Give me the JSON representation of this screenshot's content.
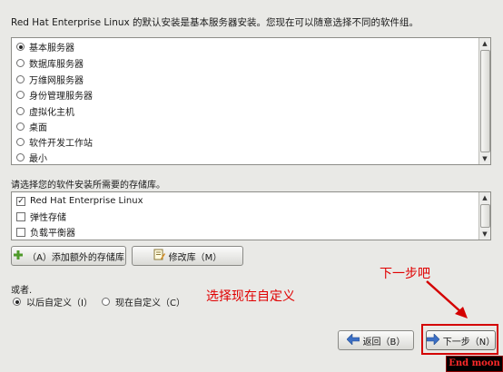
{
  "intro_text": "Red Hat Enterprise Linux 的默认安装是基本服务器安装。您现在可以随意选择不同的软件组。",
  "software_groups": {
    "selected_index": 0,
    "items": [
      "基本服务器",
      "数据库服务器",
      "万维网服务器",
      "身份管理服务器",
      "虚拟化主机",
      "桌面",
      "软件开发工作站",
      "最小"
    ]
  },
  "repo_prompt": "请选择您的软件安装所需要的存储库。",
  "repositories": [
    {
      "label": "Red Hat Enterprise Linux",
      "checked": true
    },
    {
      "label": "弹性存储",
      "checked": false
    },
    {
      "label": "负载平衡器",
      "checked": false
    }
  ],
  "add_repo_button": "（A）添加额外的存储库",
  "modify_repo_button": "修改库（M）",
  "or_label": "或者.",
  "customize_later": "以后自定义（I）",
  "customize_now": "现在自定义（C）",
  "customize_selected": "later",
  "annotation_select": "选择现在自定义",
  "annotation_next": "下一步吧",
  "back_button": "返回（B）",
  "next_button": "下一步（N）",
  "watermark": "End moon",
  "colors": {
    "annotation": "#e00000",
    "highlight_box": "#d40000",
    "accent": "#3c6fc4"
  },
  "icons": {
    "add": "plus-icon",
    "modify": "edit-icon",
    "back": "arrow-left-icon",
    "next": "arrow-right-icon"
  }
}
